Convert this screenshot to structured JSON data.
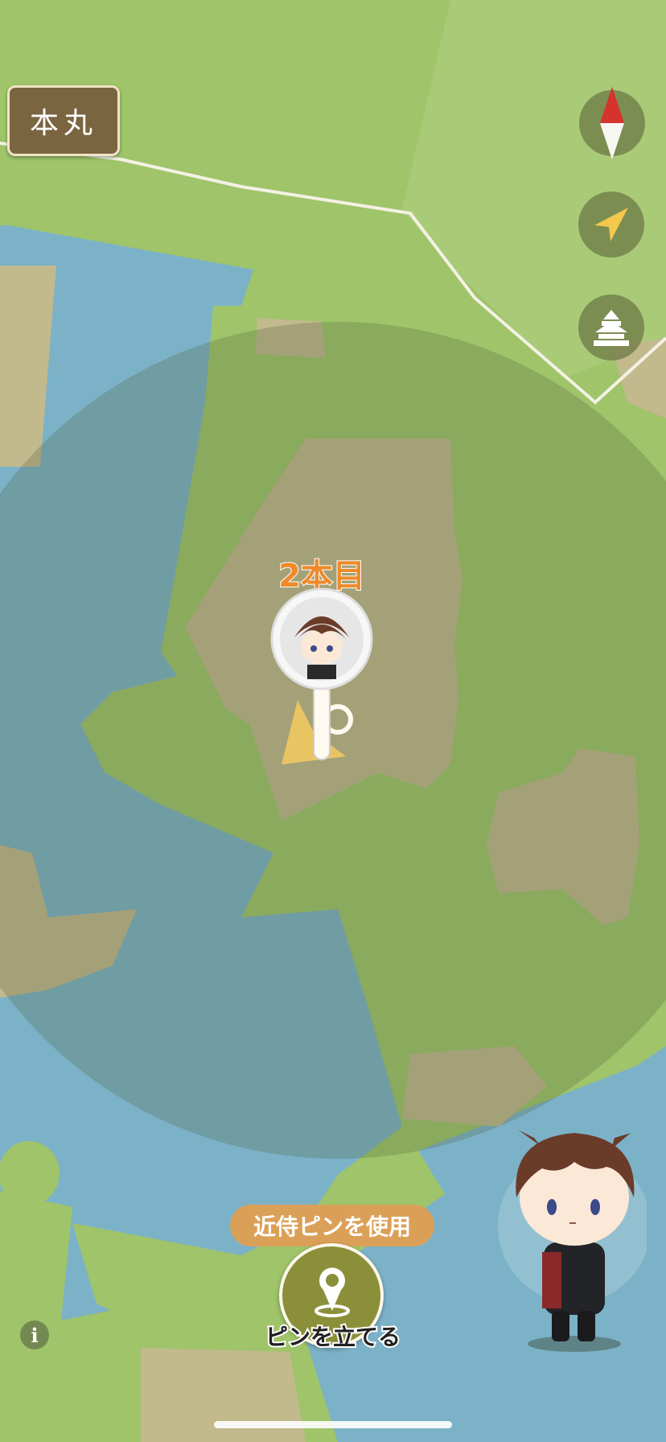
{
  "map": {
    "colors": {
      "land": "#9fc46a",
      "water": "#7cb2c7",
      "building": "#c2b98d",
      "road": "#f4f1e4",
      "range_overlay": "#4a5a3a"
    }
  },
  "header": {
    "home_button_label": "本丸"
  },
  "controls": {
    "compass_icon": "compass-icon",
    "locate_icon": "location-arrow-icon",
    "castle_icon": "castle-icon"
  },
  "marker": {
    "label": "2本目",
    "icon": "character-pin-icon",
    "label_color": "#ee8a2a"
  },
  "actions": {
    "use_pin_label": "近侍ピンを使用",
    "place_pin_label": "ピンを立てる",
    "place_pin_icon": "map-pin-icon"
  },
  "footer": {
    "info_label": "i"
  }
}
